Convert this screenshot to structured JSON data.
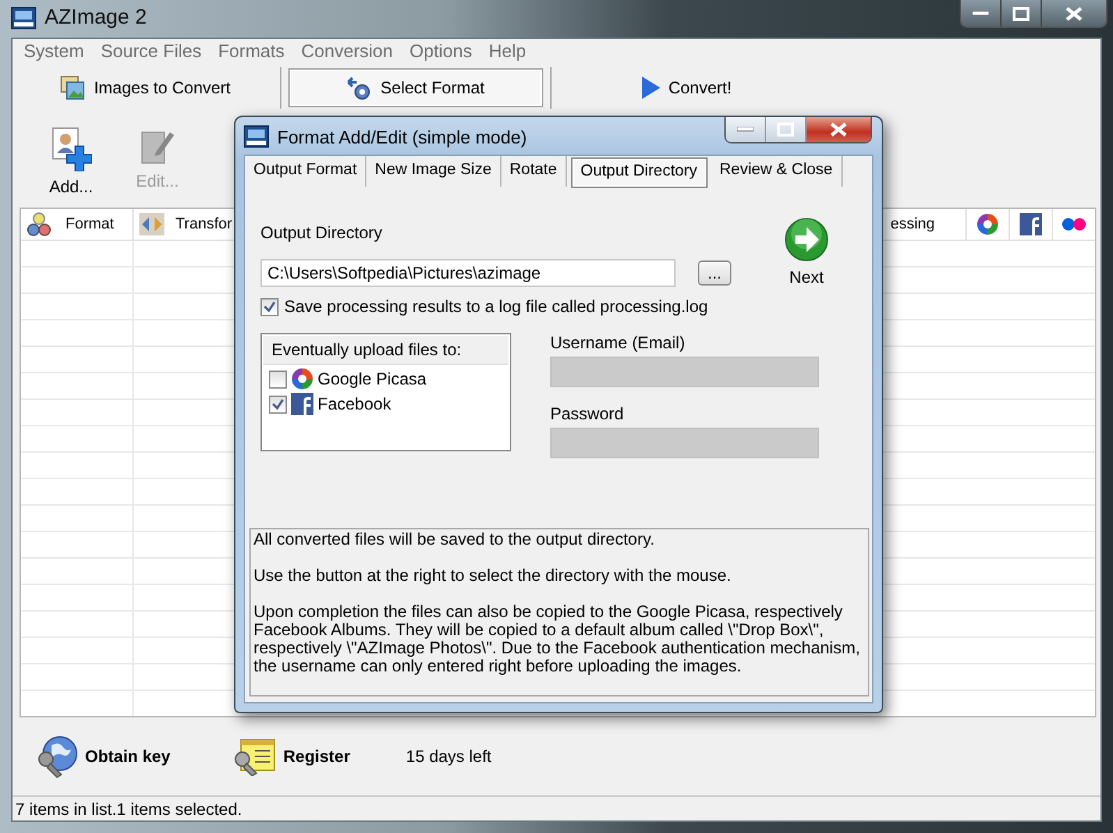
{
  "main_window": {
    "title": "AZImage 2",
    "menu": [
      "System",
      "Source Files",
      "Formats",
      "Conversion",
      "Options",
      "Help"
    ],
    "toolbar": [
      {
        "kind": "images",
        "label": "Images to Convert",
        "selected": false
      },
      {
        "kind": "format",
        "label": "Select Format",
        "selected": true
      },
      {
        "kind": "convert",
        "label": "Convert!",
        "selected": false
      }
    ],
    "actions": [
      {
        "kind": "add",
        "label": "Add...",
        "disabled": false
      },
      {
        "kind": "edit",
        "label": "Edit...",
        "disabled": true
      }
    ],
    "table": {
      "columns": [
        {
          "kind": "format",
          "label": "Format"
        },
        {
          "kind": "transform",
          "label": "Transfor"
        },
        {
          "kind": "text",
          "label": "essing"
        }
      ]
    },
    "footer_buttons": [
      {
        "kind": "globe",
        "label": "Obtain key"
      },
      {
        "kind": "register",
        "label": "Register"
      }
    ],
    "trial": "15 days left",
    "status_bar": "7 items in list.1 items selected."
  },
  "dialog": {
    "title": "Format Add/Edit (simple mode)",
    "tabs": [
      {
        "label": "Output Format",
        "selected": false
      },
      {
        "label": "New Image Size",
        "selected": false
      },
      {
        "label": "Rotate",
        "selected": false
      },
      {
        "label": "Output Directory",
        "selected": true
      },
      {
        "label": "Review & Close",
        "selected": false
      }
    ],
    "output_directory_label": "Output Directory",
    "output_directory": "C:\\Users\\Softpedia\\Pictures\\azimage",
    "browse_button": "...",
    "next_button": "Next",
    "log_option": {
      "label": "Save processing results to a log file called processing.log",
      "checked": true
    },
    "upload": {
      "title": "Eventually upload files to:",
      "services": [
        {
          "kind": "picasa",
          "label": "Google Picasa",
          "checked": false
        },
        {
          "kind": "facebook",
          "label": "Facebook",
          "checked": true
        }
      ]
    },
    "username": {
      "label": "Username (Email)",
      "disabled": true
    },
    "password": {
      "label": "Password",
      "disabled": true
    },
    "info": [
      "All converted files will be saved to the output directory.",
      "Use the button at the right to select the directory with the mouse.",
      "Upon completion the files can also be copied to the Google Picasa, respectively Facebook Albums. They will be copied to a default album called \\\"Drop Box\\\", respectively \\\"AZImage Photos\\\". Due to the Facebook authentication mechanism, the username can only entered right before uploading the images."
    ]
  }
}
